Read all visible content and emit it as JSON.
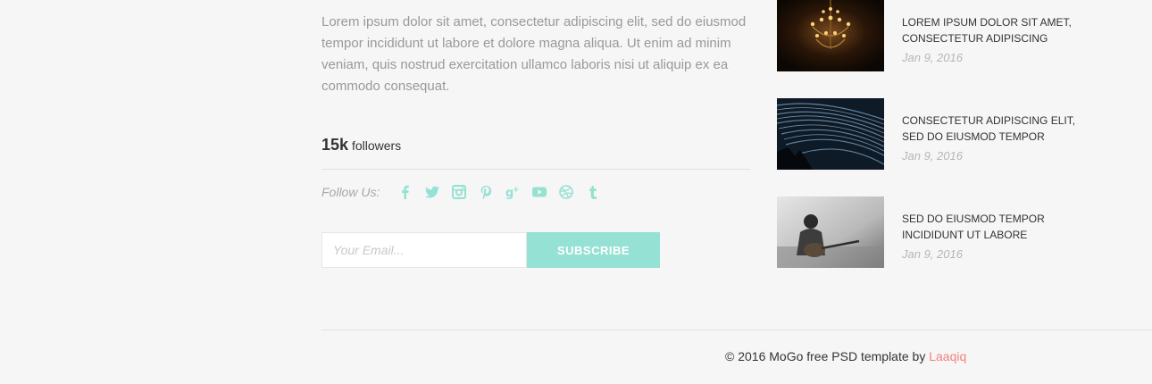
{
  "about": {
    "text": "Lorem ipsum dolor sit amet, consectetur adipiscing elit, sed do eiusmod tempor incididunt ut labore et dolore magna aliqua. Ut enim ad minim veniam, quis nostrud exercitation ullamco laboris nisi ut aliquip ex ea commodo consequat."
  },
  "followers": {
    "count": "15k",
    "label": "followers"
  },
  "follow": {
    "label": "Follow Us:",
    "icons": [
      "facebook-icon",
      "twitter-icon",
      "instagram-icon",
      "pinterest-icon",
      "google-plus-icon",
      "youtube-icon",
      "dribbble-icon",
      "tumblr-icon"
    ]
  },
  "subscribe": {
    "placeholder": "Your Email...",
    "button_label": "SUBSCRIBE"
  },
  "posts": [
    {
      "title": "Lorem ipsum dolor sit amet, consectetur adipiscing",
      "date": "Jan 9, 2016",
      "image": "chandelier-photo"
    },
    {
      "title": "Consectetur adipiscing elit, sed do eiusmod tempor",
      "date": "Jan 9, 2016",
      "image": "star-trails-photo"
    },
    {
      "title": "Sed do eiusmod tempor incididunt ut labore",
      "date": "Jan 9, 2016",
      "image": "guitar-player-photo"
    }
  ],
  "footer": {
    "copyright_prefix": "© 2016 MoGo free PSD template by ",
    "author_link": "Laaqiq"
  },
  "colors": {
    "accent": "#95e1d3",
    "link": "#f38181",
    "muted_text": "#999999",
    "dark_text": "#333333"
  }
}
